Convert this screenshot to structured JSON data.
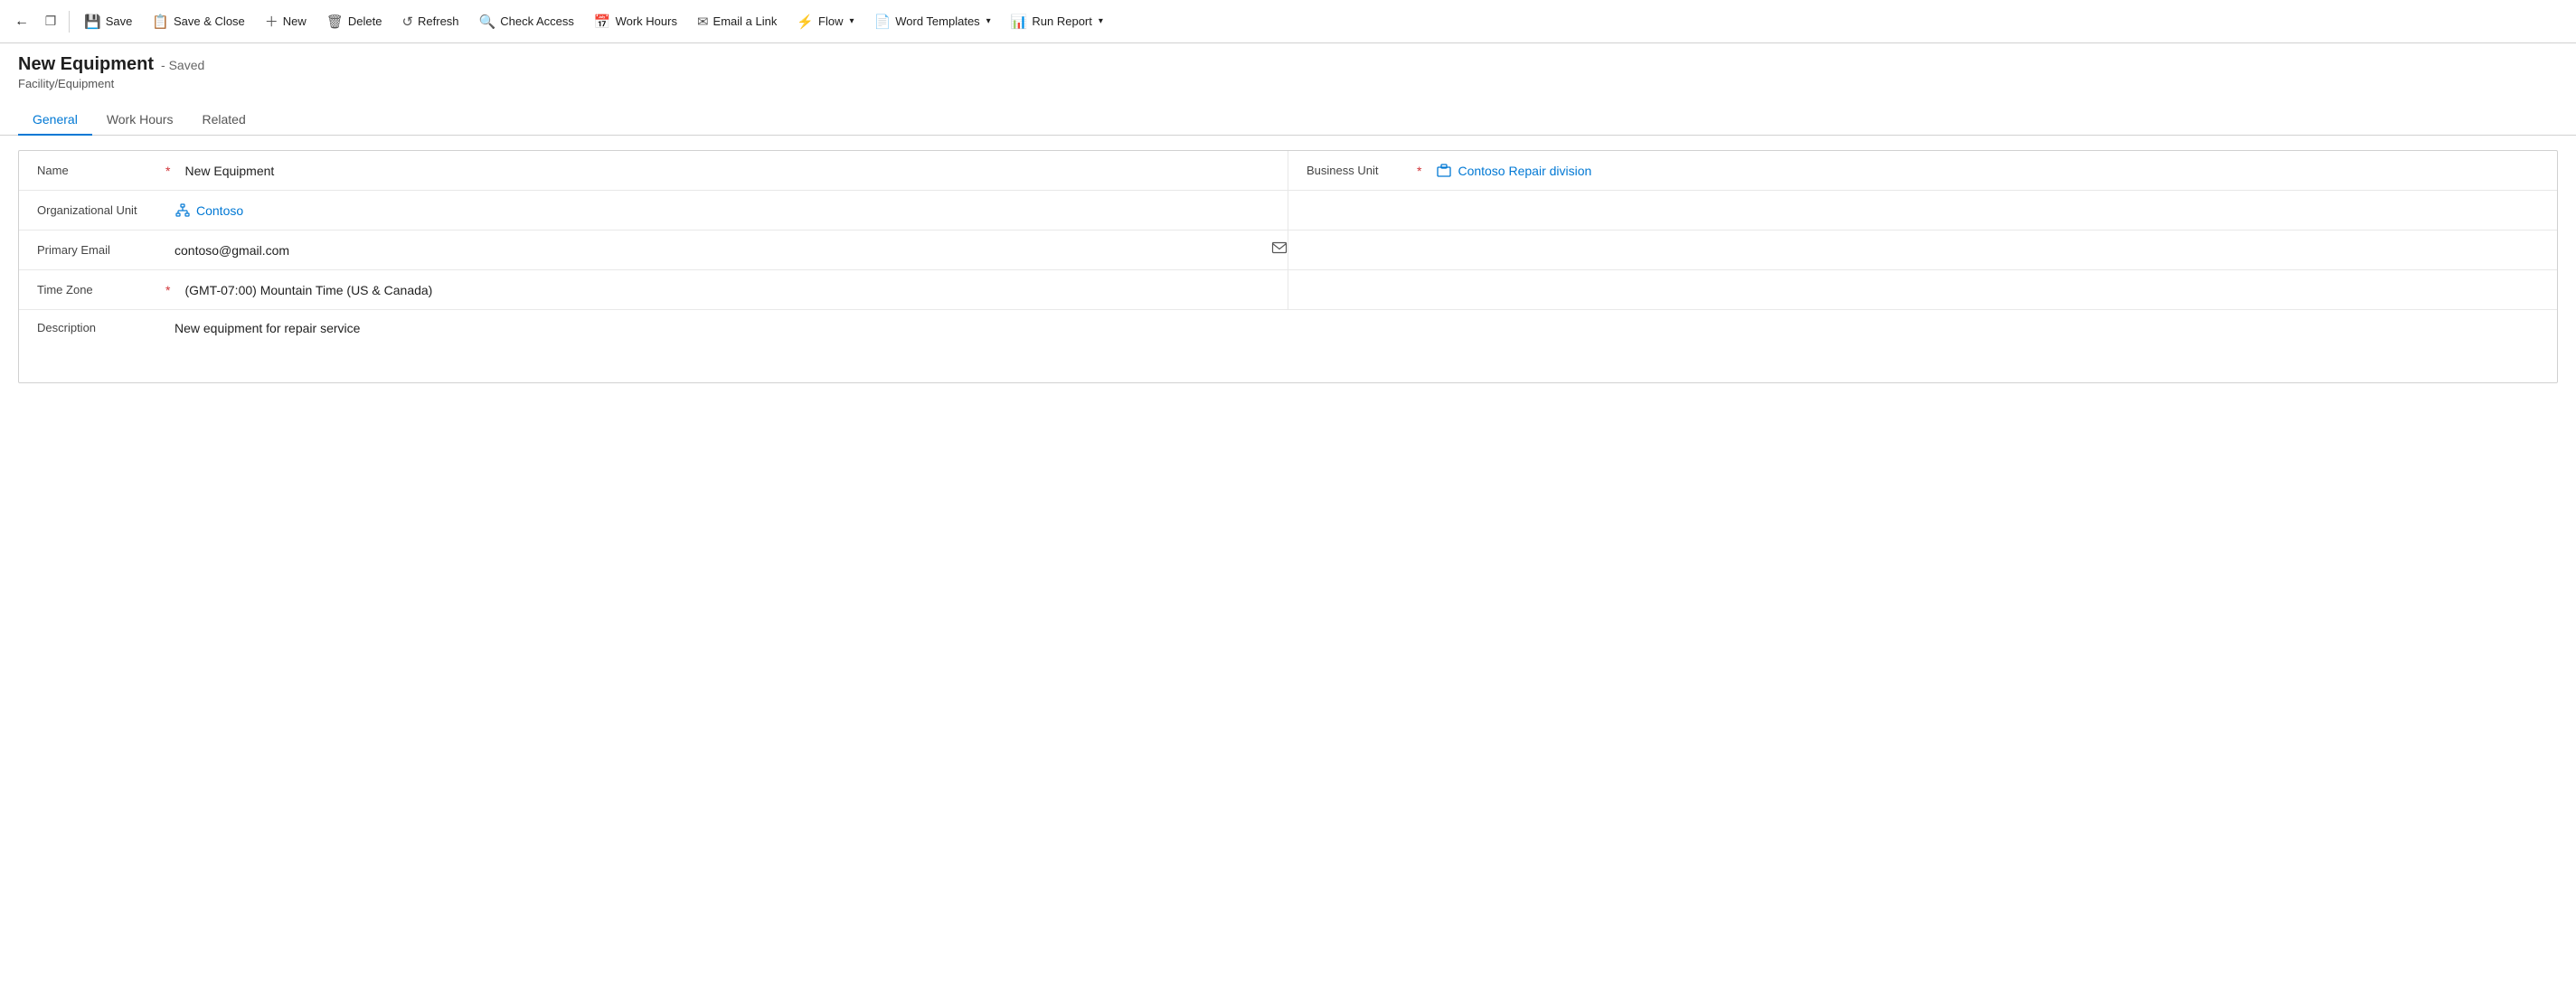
{
  "toolbar": {
    "back_label": "←",
    "window_label": "⧉",
    "save_label": "Save",
    "save_close_label": "Save & Close",
    "new_label": "New",
    "delete_label": "Delete",
    "refresh_label": "Refresh",
    "check_access_label": "Check Access",
    "work_hours_label": "Work Hours",
    "email_link_label": "Email a Link",
    "flow_label": "Flow",
    "word_templates_label": "Word Templates",
    "run_report_label": "Run Report"
  },
  "page": {
    "title": "New Equipment",
    "saved_status": "- Saved",
    "subtitle": "Facility/Equipment"
  },
  "tabs": [
    {
      "label": "General",
      "active": true
    },
    {
      "label": "Work Hours",
      "active": false
    },
    {
      "label": "Related",
      "active": false
    }
  ],
  "form": {
    "name_label": "Name",
    "name_required": "*",
    "name_value": "New Equipment",
    "business_unit_label": "Business Unit",
    "business_unit_required": "*",
    "business_unit_value": "Contoso Repair division",
    "org_unit_label": "Organizational Unit",
    "org_unit_value": "Contoso",
    "primary_email_label": "Primary Email",
    "primary_email_value": "contoso@gmail.com",
    "time_zone_label": "Time Zone",
    "time_zone_required": "*",
    "time_zone_value": "(GMT-07:00) Mountain Time (US & Canada)",
    "description_label": "Description",
    "description_value": "New equipment for repair service"
  }
}
